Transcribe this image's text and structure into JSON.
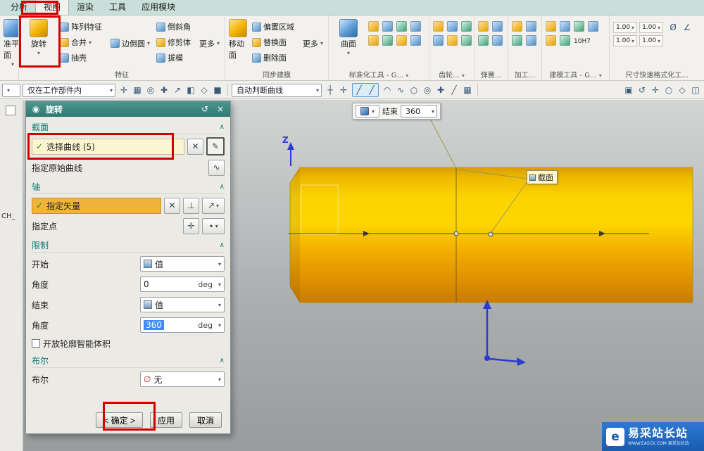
{
  "glyphs": {
    "caret": "▾",
    "chevron_up": "∧",
    "check": "✓",
    "close": "×",
    "reset": "↺",
    "gear_dot": "◉",
    "cross": "✕",
    "perp": "⊥",
    "vector": "↗",
    "point_cross": "✛",
    "curve": "∿",
    "sketch": "✎",
    "dot": "∙",
    "diameter": "Ø",
    "angle": "∠",
    "none_icon": "∅"
  },
  "tabs": [
    "分析",
    "视图",
    "渲染",
    "工具",
    "应用模块"
  ],
  "ribbon": {
    "partial_label": "准平面",
    "groups_labels": {
      "features": "特征",
      "sync": "同步建模",
      "std": "标准化工具 - G...",
      "gear": "齿轮...",
      "spring": "弹簧...",
      "machining": "加工...",
      "modeling": "建模工具 - G...",
      "dimension": "尺寸快速格式化工..."
    },
    "features": {
      "revolve_label": "旋转",
      "col1": [
        {
          "n": "pattern-feature-button",
          "label": "阵列特征",
          "c": ""
        },
        {
          "n": "unite-button",
          "label": "合并",
          "c": "▾"
        },
        {
          "n": "shell-button",
          "label": "抽壳",
          "c": ""
        }
      ],
      "mid": [
        {
          "n": "edge-blend-button",
          "label": "边倒圆",
          "c": "▾"
        }
      ],
      "col2": [
        {
          "n": "chamfer-button",
          "label": "倒斜角",
          "c": ""
        },
        {
          "n": "trim-body-button",
          "label": "修剪体",
          "c": ""
        },
        {
          "n": "draft-button",
          "label": "拔模",
          "c": ""
        }
      ],
      "more_label": "更多"
    },
    "sync": {
      "move_face_label": "移动面",
      "col1": [
        {
          "n": "offset-region-button",
          "label": "偏置区域",
          "c": ""
        },
        {
          "n": "replace-face-button",
          "label": "替换面",
          "c": ""
        },
        {
          "n": "delete-face-button",
          "label": "删除面",
          "c": ""
        }
      ],
      "more_label": "更多"
    },
    "std": {
      "surface_label": "曲面"
    },
    "modeling": {
      "tol_label": "10H7"
    },
    "dimension": {
      "vals": [
        {
          "n": "dim-value-button",
          "label": "1.00",
          "c": "▾"
        },
        {
          "n": "dim-value-button",
          "label": "1.00",
          "c": "▾"
        },
        {
          "n": "dim-value-button",
          "label": "1.00",
          "c": "▾"
        },
        {
          "n": "dim-value-button",
          "label": "1.00",
          "c": "▾"
        }
      ]
    }
  },
  "toolbar": {
    "scope_value": "仅在工作部件内",
    "curve_rule_value": "自动判断曲线",
    "icons_a": [
      {
        "n": "touch-mode-icon",
        "g": "✛"
      },
      {
        "n": "selection-filter-icon",
        "g": "▦"
      },
      {
        "n": "snap-point-icon",
        "g": "◎"
      },
      {
        "n": "wcs-icon",
        "g": "✚"
      },
      {
        "n": "move-object-icon",
        "g": "↗"
      },
      {
        "n": "show-hide-icon",
        "g": "◧"
      },
      {
        "n": "datum-plane-icon",
        "g": "◇"
      },
      {
        "n": "solid-body-icon",
        "g": "■"
      }
    ],
    "icons_b1": [
      {
        "n": "point-constructor-icon",
        "g": "┼"
      },
      {
        "n": "plus-icon",
        "g": "✛"
      }
    ],
    "icons_hl": [
      {
        "n": "line-tool-icon",
        "g": "╱"
      },
      {
        "n": "line-tool-alt-icon",
        "g": "╱"
      }
    ],
    "icons_b2": [
      {
        "n": "arc-icon",
        "g": "◠"
      },
      {
        "n": "spline-icon",
        "g": "∿"
      },
      {
        "n": "circle-icon",
        "g": "○"
      },
      {
        "n": "ellipse-icon",
        "g": "◎"
      },
      {
        "n": "cross-icon",
        "g": "✚"
      },
      {
        "n": "line-icon",
        "g": "╱"
      },
      {
        "n": "grid-icon",
        "g": "▦"
      }
    ],
    "icons_c": [
      {
        "n": "window-icon",
        "g": "▣"
      },
      {
        "n": "rotate-view-icon",
        "g": "↺"
      },
      {
        "n": "pan-view-icon",
        "g": "✛"
      },
      {
        "n": "zoom-view-icon",
        "g": "○"
      },
      {
        "n": "perspective-icon",
        "g": "◇"
      },
      {
        "n": "section-view-icon",
        "g": "◫"
      }
    ]
  },
  "dialog": {
    "title": "旋转",
    "section": {
      "title": "截面",
      "select_curve": "选择曲线 (5)",
      "orig_curve": "指定原始曲线"
    },
    "axis": {
      "title": "轴",
      "vector": "指定矢量",
      "point": "指定点"
    },
    "limits": {
      "title": "限制",
      "start_label": "开始",
      "start_value": "值",
      "angle1_label": "角度",
      "angle1_value": "0",
      "angle1_unit": "deg",
      "end_label": "结束",
      "end_value": "值",
      "angle2_label": "角度",
      "angle2_value": "360",
      "angle2_unit": "deg",
      "open_profile": "开放轮廓智能体积"
    },
    "boolean": {
      "title": "布尔",
      "label": "布尔",
      "value": "无"
    },
    "buttons": {
      "ok": "< 确定 >",
      "apply": "应用",
      "cancel": "取消"
    }
  },
  "viewport": {
    "mini_end_label": "结束",
    "mini_end_value": "360",
    "section_tag": "截面",
    "z_axis_label": "Z"
  },
  "sidebar": {
    "label": "CH_"
  },
  "watermark": {
    "title": "易采站长站",
    "subtitle": "WWW.EASCK.COM 易采站长站"
  },
  "colors": {
    "accent_teal": "#2f7f78",
    "highlight_orange": "#f2b33d",
    "selection_blue": "#3f8cff",
    "annotation_red": "#d40000",
    "solid_gold": "#f7c400"
  }
}
